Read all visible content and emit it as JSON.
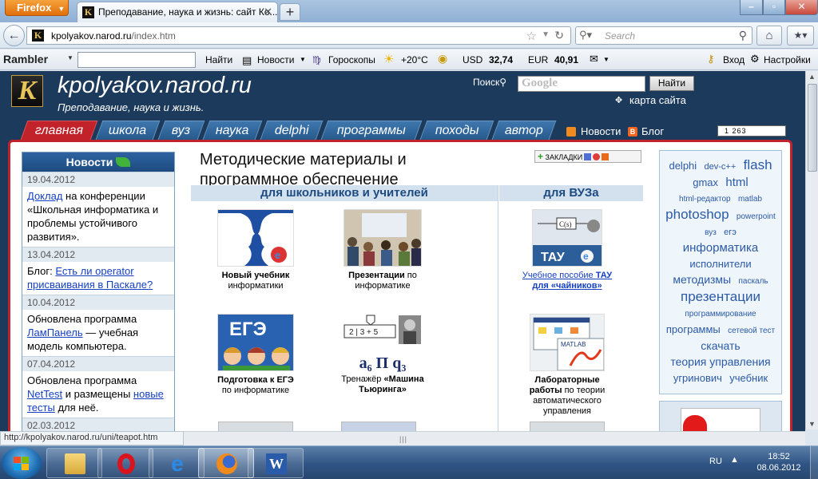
{
  "browser": {
    "app_button": "Firefox",
    "tab_title": "Преподавание, наука и жизнь: сайт Ко...",
    "url_domain": "kpolyakov.narod.ru",
    "url_path": "/index.htm",
    "search_placeholder": "Search",
    "status_url": "http://kpolyakov.narod.ru/uni/teapot.htm"
  },
  "rambler": {
    "logo": "Rambler",
    "find": "Найти",
    "news": "Новости",
    "horoscope": "Гороскопы",
    "temperature": "+20°C",
    "usd_label": "USD",
    "usd_value": "32,74",
    "eur_label": "EUR",
    "eur_value": "40,91",
    "login": "Вход",
    "settings": "Настройки"
  },
  "site": {
    "logo_letter": "K",
    "title": "kpolyakov.narod.ru",
    "slogan": "Преподавание, наука и жизнь.",
    "search_label": "Поиск",
    "search_button": "Найти",
    "search_engine_logo": "Google",
    "sitemap": "карта сайта",
    "nav": [
      "главная",
      "школа",
      "вуз",
      "наука",
      "delphi",
      "программы",
      "походы",
      "автор"
    ],
    "news_link": "Новости",
    "blog_link": "Блог",
    "blog_icon_letter": "B",
    "counter": "1 263"
  },
  "news": {
    "header": "Новости",
    "items": [
      {
        "date": "19.04.2012",
        "link": "Доклад",
        "text": " на конференции «Школьная информатика и проблемы устойчивого развития»."
      },
      {
        "date": "13.04.2012",
        "pre": "Блог: ",
        "link": "Есть ли operator присваивания в Паскале?"
      },
      {
        "date": "10.04.2012",
        "pre": "Обновлена программа ",
        "link": "ЛамПанель",
        "text": " — учебная модель компьютера."
      },
      {
        "date": "07.04.2012",
        "pre": "Обновлена программа ",
        "link": "NetTest",
        "mid": " и размещены ",
        "link2": "новые тесты",
        "text": " для неё."
      },
      {
        "date": "02.03.2012"
      }
    ]
  },
  "main": {
    "heading": "Методические материалы и программное обеспечение",
    "bookmarks": "ЗАКЛАДКИ",
    "school_header": "для школьников и учителей",
    "vuz_header": "для ВУЗа",
    "cards": {
      "textbook_title": "Новый учебник",
      "textbook_sub": "информатики",
      "pres_title": "Презентации",
      "pres_sub1": " по",
      "pres_sub2": "информатике",
      "tau_pre": "Учебное пособие ",
      "tau_b1": "ТАУ",
      "tau_b2": "для «чайников»",
      "tau_label": "ТАУ",
      "tau_block": "C(s)",
      "ege_title": "Подготовка к ЕГЭ",
      "ege_sub": "по информатике",
      "ege_logo": "ЕГЭ",
      "turing_pre": "Тренажёр ",
      "turing_b1": "«Машина",
      "turing_b2": "Тьюринга»",
      "turing_tape": "2 | 3 + 5",
      "turing_formula": "a₆ Π q₃",
      "lab_title1": "Лабораторные",
      "lab_title2": "работы",
      "lab_sub1": " по теории",
      "lab_sub2": "автоматического",
      "lab_sub3": "управления",
      "lab_matlab": "MATLAB"
    }
  },
  "tags": [
    {
      "t": "delphi",
      "s": 13
    },
    {
      "t": "dev-c++",
      "s": 11
    },
    {
      "t": "flash",
      "s": 17
    },
    {
      "t": "gmax",
      "s": 13
    },
    {
      "t": "html",
      "s": 15
    },
    {
      "t": "html-редактор",
      "s": 10
    },
    {
      "t": "matlab",
      "s": 10
    },
    {
      "t": "photoshop",
      "s": 17
    },
    {
      "t": "powerpoint",
      "s": 10
    },
    {
      "t": "вуз",
      "s": 10
    },
    {
      "t": "егэ",
      "s": 11
    },
    {
      "t": "информатика",
      "s": 15
    },
    {
      "t": "исполнители",
      "s": 13
    },
    {
      "t": "методизмы",
      "s": 14
    },
    {
      "t": "паскаль",
      "s": 10
    },
    {
      "t": "презентации",
      "s": 17
    },
    {
      "t": "программирование",
      "s": 10
    },
    {
      "t": "программы",
      "s": 13
    },
    {
      "t": "сетевой тест",
      "s": 10
    },
    {
      "t": "скачать",
      "s": 14
    },
    {
      "t": "теория управления",
      "s": 14
    },
    {
      "t": "угринович",
      "s": 13
    },
    {
      "t": "учебник",
      "s": 13
    }
  ],
  "taskbar": {
    "lang": "RU",
    "time": "18:52",
    "date": "08.06.2012"
  },
  "colors": {
    "accent_red": "#c2222a",
    "nav_blue": "#265a8c",
    "page_bg": "#1b3a5c",
    "link": "#1540c2"
  }
}
